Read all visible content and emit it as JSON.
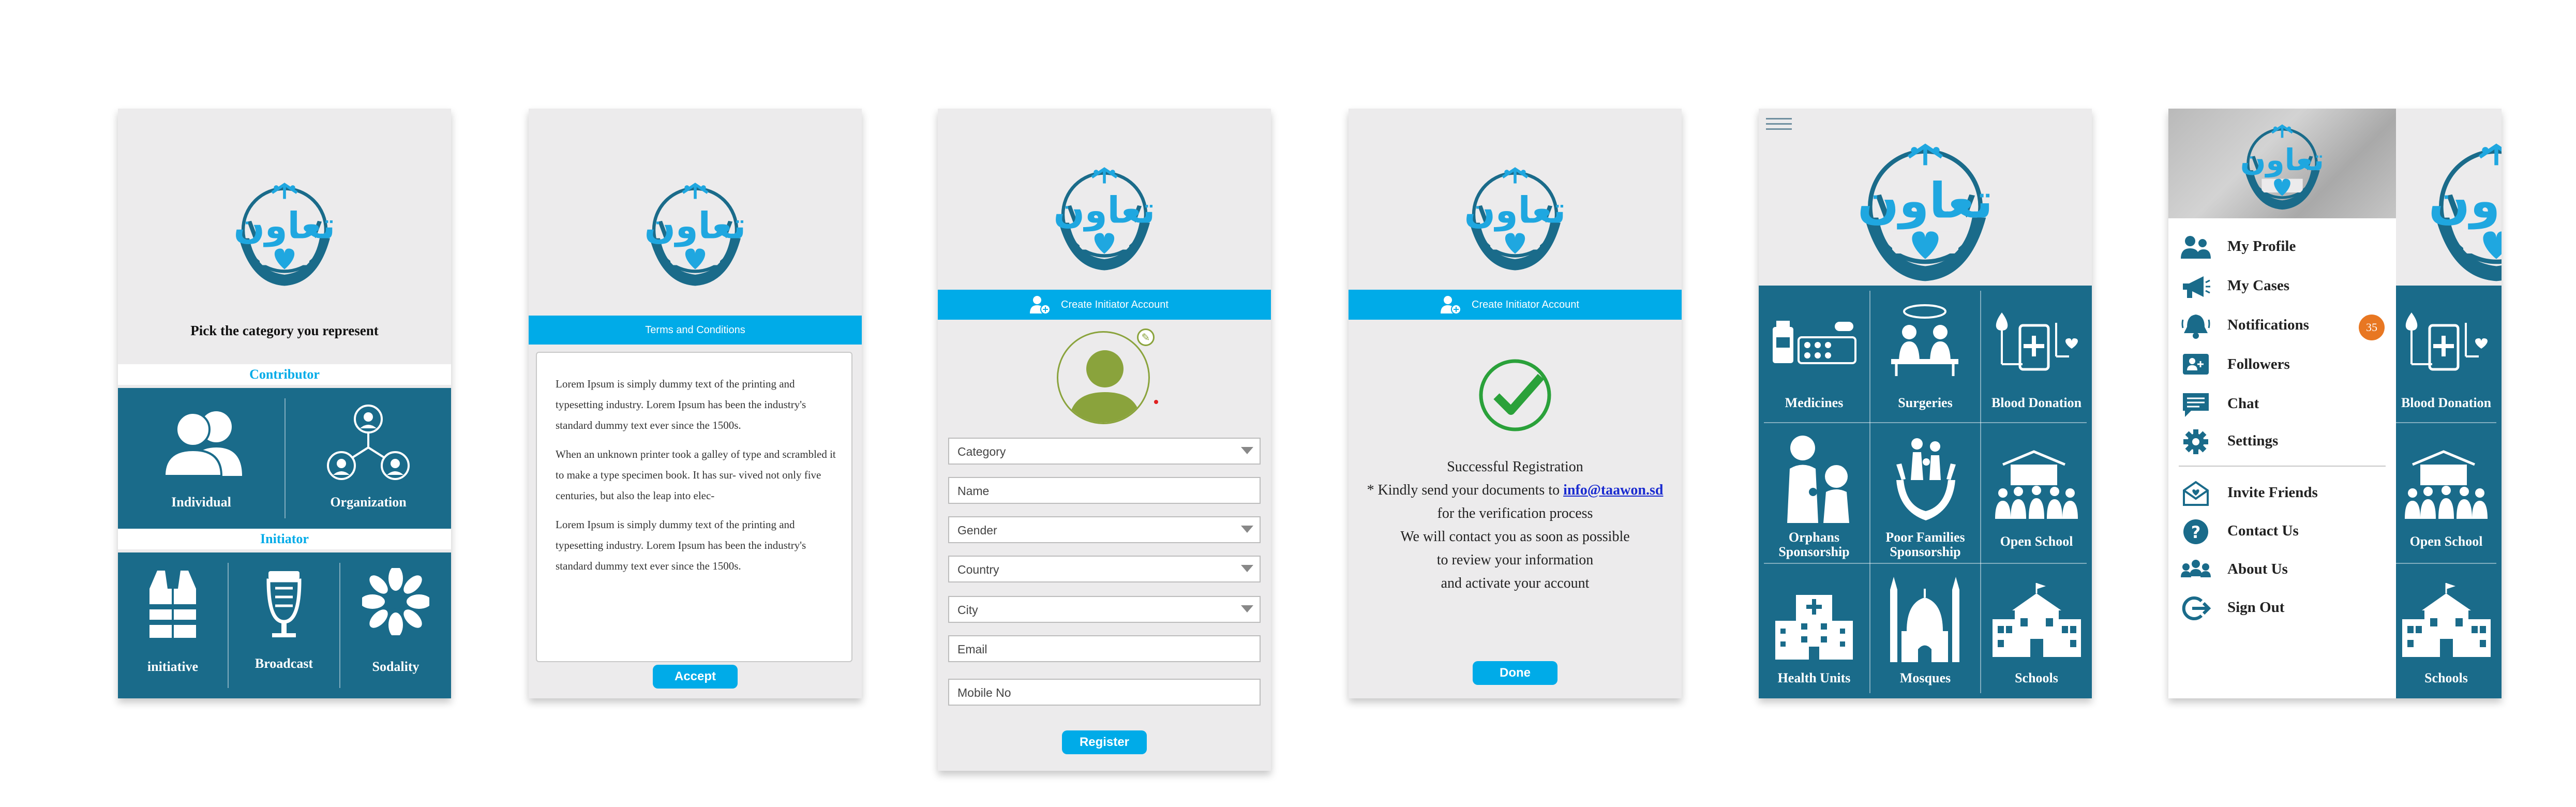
{
  "colors": {
    "primary_blue": "#00abe8",
    "tile_teal": "#1a6b8a",
    "logo_dark": "#1a6b8a",
    "logo_light": "#1fa7e0",
    "check_green": "#2aa13a",
    "avatar_olive": "#8aa33c",
    "badge_orange": "#e87722",
    "background": "#ecebec"
  },
  "screen1": {
    "prompt": "Pick the category you represent",
    "contributor_header": "Contributor",
    "initiator_header": "Initiator",
    "contributor_tiles": [
      {
        "label": "Individual",
        "icon": "people-icon"
      },
      {
        "label": "Organization",
        "icon": "org-network-icon"
      }
    ],
    "initiator_tiles": [
      {
        "label": "initiative",
        "icon": "vest-icon"
      },
      {
        "label": "Broadcast",
        "icon": "microphone-icon"
      },
      {
        "label": "Sodality",
        "icon": "hands-circle-icon"
      }
    ]
  },
  "screen2": {
    "bar_title": "Terms and Conditions",
    "para1": "Lorem Ipsum is simply dummy text of the printing and typesetting industry. Lorem Ipsum has been the industry's standard dummy text ever since the 1500s.",
    "para2": "When an unknown printer took a galley of type and scrambled it to make a type specimen book. It has sur- vived not only five centuries, but also the leap into elec-",
    "para3": "Lorem Ipsum is simply dummy text of the printing and typesetting industry. Lorem Ipsum has been the industry's standard dummy text ever since the 1500s.",
    "accept_label": "Accept"
  },
  "screen3": {
    "bar_title": "Create Initiator Account",
    "fields": {
      "category": "Category",
      "name": "Name",
      "gender": "Gender",
      "country": "Country",
      "city": "City",
      "email": "Email",
      "mobile": "Mobile No"
    },
    "register_label": "Register"
  },
  "screen4": {
    "bar_title": "Create Initiator Account",
    "line1": "Successful Registration",
    "line2_prefix": "* Kindly send your documents to ",
    "email_link": "info@taawon.sd",
    "line3": "for the verification process",
    "line4": "We will contact you as soon as possible",
    "line5": "to review your information",
    "line6": "and activate your account",
    "done_label": "Done"
  },
  "screen5": {
    "tiles": [
      {
        "label": "Medicines",
        "icon": "medicines-icon"
      },
      {
        "label": "Surgeries",
        "icon": "surgery-icon"
      },
      {
        "label": "Blood Donation",
        "icon": "blood-donation-icon"
      },
      {
        "label1": "Orphans",
        "label2": "Sponsorship",
        "icon": "orphans-icon"
      },
      {
        "label1": "Poor Families",
        "label2": "Sponsorship",
        "icon": "families-icon"
      },
      {
        "label": "Open School",
        "icon": "open-school-icon"
      },
      {
        "label": "Health Units",
        "icon": "hospital-icon"
      },
      {
        "label": "Mosques",
        "icon": "mosque-icon"
      },
      {
        "label": "Schools",
        "icon": "school-icon"
      }
    ]
  },
  "screen6": {
    "menu": [
      {
        "label": "My Profile",
        "icon": "profile-icon"
      },
      {
        "label": "My Cases",
        "icon": "megaphone-icon"
      },
      {
        "label": "Notifications",
        "icon": "bell-icon",
        "badge": "35"
      },
      {
        "label": "Followers",
        "icon": "followers-icon"
      },
      {
        "label": "Chat",
        "icon": "chat-icon"
      },
      {
        "label": "Settings",
        "icon": "gear-icon"
      },
      {
        "label": "Invite Friends",
        "icon": "invite-icon"
      },
      {
        "label": "Contact Us",
        "icon": "help-icon"
      },
      {
        "label": "About Us",
        "icon": "group-icon"
      },
      {
        "label": "Sign Out",
        "icon": "signout-icon"
      }
    ],
    "peek_tiles": {
      "blood": "Blood Donation",
      "open_school": "Open School",
      "schools": "Schools"
    }
  }
}
